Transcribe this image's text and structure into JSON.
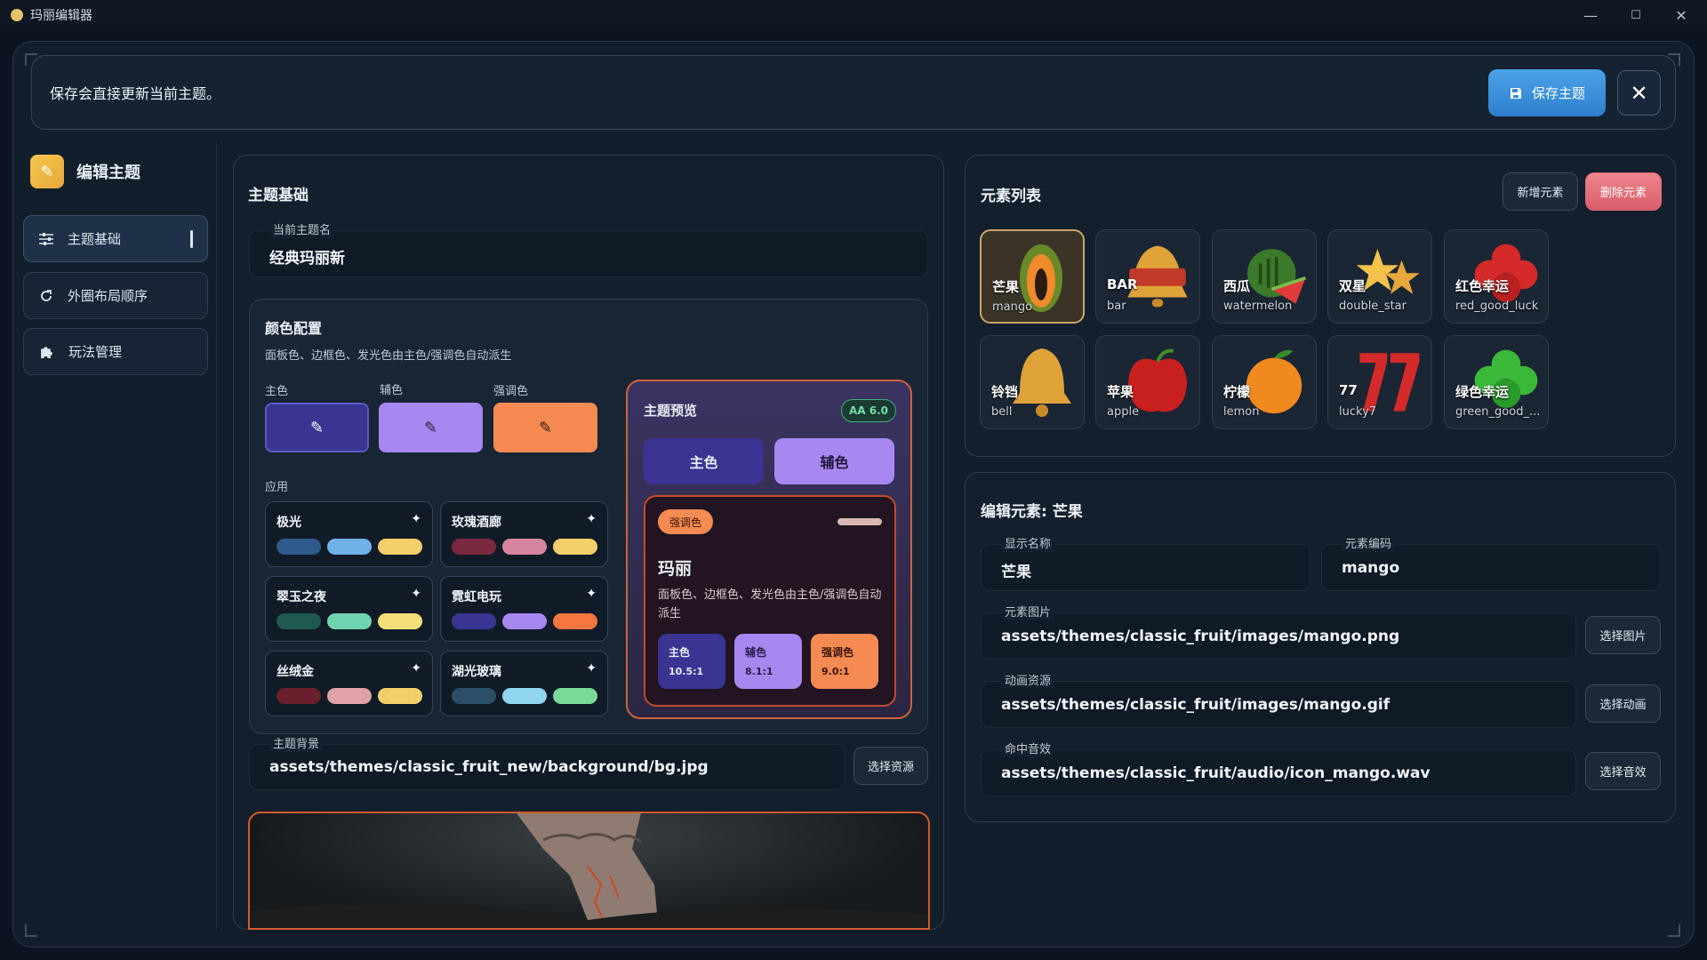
{
  "window": {
    "title": "玛丽编辑器",
    "minimize_icon": "—",
    "maximize_icon": "☐",
    "close_icon": "✕"
  },
  "banner": {
    "message": "保存会直接更新当前主题。",
    "save_label": "保存主题"
  },
  "sidebar": {
    "header": "编辑主题",
    "items": [
      {
        "label": "主题基础",
        "icon": "sliders-icon"
      },
      {
        "label": "外圈布局顺序",
        "icon": "refresh-icon"
      },
      {
        "label": "玩法管理",
        "icon": "puzzle-icon"
      }
    ]
  },
  "basics": {
    "title": "主题基础",
    "name_label": "当前主题名",
    "name_value": "经典玛丽新",
    "color_config": {
      "title": "颜色配置",
      "hint": "面板色、边框色、发光色由主色/强调色自动派生",
      "primary_label": "主色",
      "secondary_label": "辅色",
      "accent_label": "强调色",
      "primary_color": "#3a3493",
      "secondary_color": "#a887f0",
      "accent_color": "#f58a52",
      "apply_label": "应用",
      "presets": [
        {
          "name": "极光",
          "colors": [
            "#2f5a8c",
            "#6fb2e8",
            "#f2cf6a"
          ]
        },
        {
          "name": "玫瑰酒廊",
          "colors": [
            "#7a2a40",
            "#d784a0",
            "#f2cf6a"
          ]
        },
        {
          "name": "翠玉之夜",
          "colors": [
            "#1f5a4e",
            "#6fd3b0",
            "#f2df7a"
          ]
        },
        {
          "name": "霓虹电玩",
          "colors": [
            "#3a3493",
            "#a887f0",
            "#f5763f"
          ]
        },
        {
          "name": "丝绒金",
          "colors": [
            "#6a1f2c",
            "#e0a1a8",
            "#f2cf6a"
          ]
        },
        {
          "name": "湖光玻璃",
          "colors": [
            "#2a4f66",
            "#8fd6ee",
            "#7ad899"
          ]
        }
      ]
    },
    "preview": {
      "title": "主题预览",
      "badge": "AA 6.0",
      "primary_button": "主色",
      "secondary_button": "辅色",
      "accent_tag": "强调色",
      "card_title": "玛丽",
      "card_text": "面板色、边框色、发光色由主色/强调色自动派生",
      "ratios": [
        {
          "label": "主色",
          "value": "10.5:1"
        },
        {
          "label": "辅色",
          "value": "8.1:1"
        },
        {
          "label": "强调色",
          "value": "9.0:1"
        }
      ]
    },
    "background": {
      "label": "主题背景",
      "value": "assets/themes/classic_fruit_new/background/bg.jpg",
      "button": "选择资源"
    }
  },
  "elements": {
    "title": "元素列表",
    "add_button": "新增元素",
    "delete_button": "删除元素",
    "items": [
      {
        "name": "芒果",
        "code": "mango",
        "icon": "papaya-icon"
      },
      {
        "name": "BAR",
        "code": "bar",
        "icon": "bar-bell-icon"
      },
      {
        "name": "西瓜",
        "code": "watermelon",
        "icon": "watermelon-icon"
      },
      {
        "name": "双星",
        "code": "double_star",
        "icon": "double-star-icon"
      },
      {
        "name": "红色幸运",
        "code": "red_good_luck",
        "icon": "red-clover-icon"
      },
      {
        "name": "铃铛",
        "code": "bell",
        "icon": "bell-icon"
      },
      {
        "name": "苹果",
        "code": "apple",
        "icon": "apple-icon"
      },
      {
        "name": "柠檬",
        "code": "lemon",
        "icon": "orange-icon"
      },
      {
        "name": "77",
        "code": "lucky7",
        "icon": "lucky-seven-icon"
      },
      {
        "name": "绿色幸运",
        "code": "green_good_...",
        "icon": "green-clover-icon"
      }
    ]
  },
  "edit": {
    "title": "编辑元素: 芒果",
    "display_name_label": "显示名称",
    "display_name_value": "芒果",
    "code_label": "元素编码",
    "code_value": "mango",
    "image_label": "元素图片",
    "image_value": "assets/themes/classic_fruit/images/mango.png",
    "image_button": "选择图片",
    "anim_label": "动画资源",
    "anim_value": "assets/themes/classic_fruit/images/mango.gif",
    "anim_button": "选择动画",
    "sound_label": "命中音效",
    "sound_value": "assets/themes/classic_fruit/audio/icon_mango.wav",
    "sound_button": "选择音效"
  }
}
